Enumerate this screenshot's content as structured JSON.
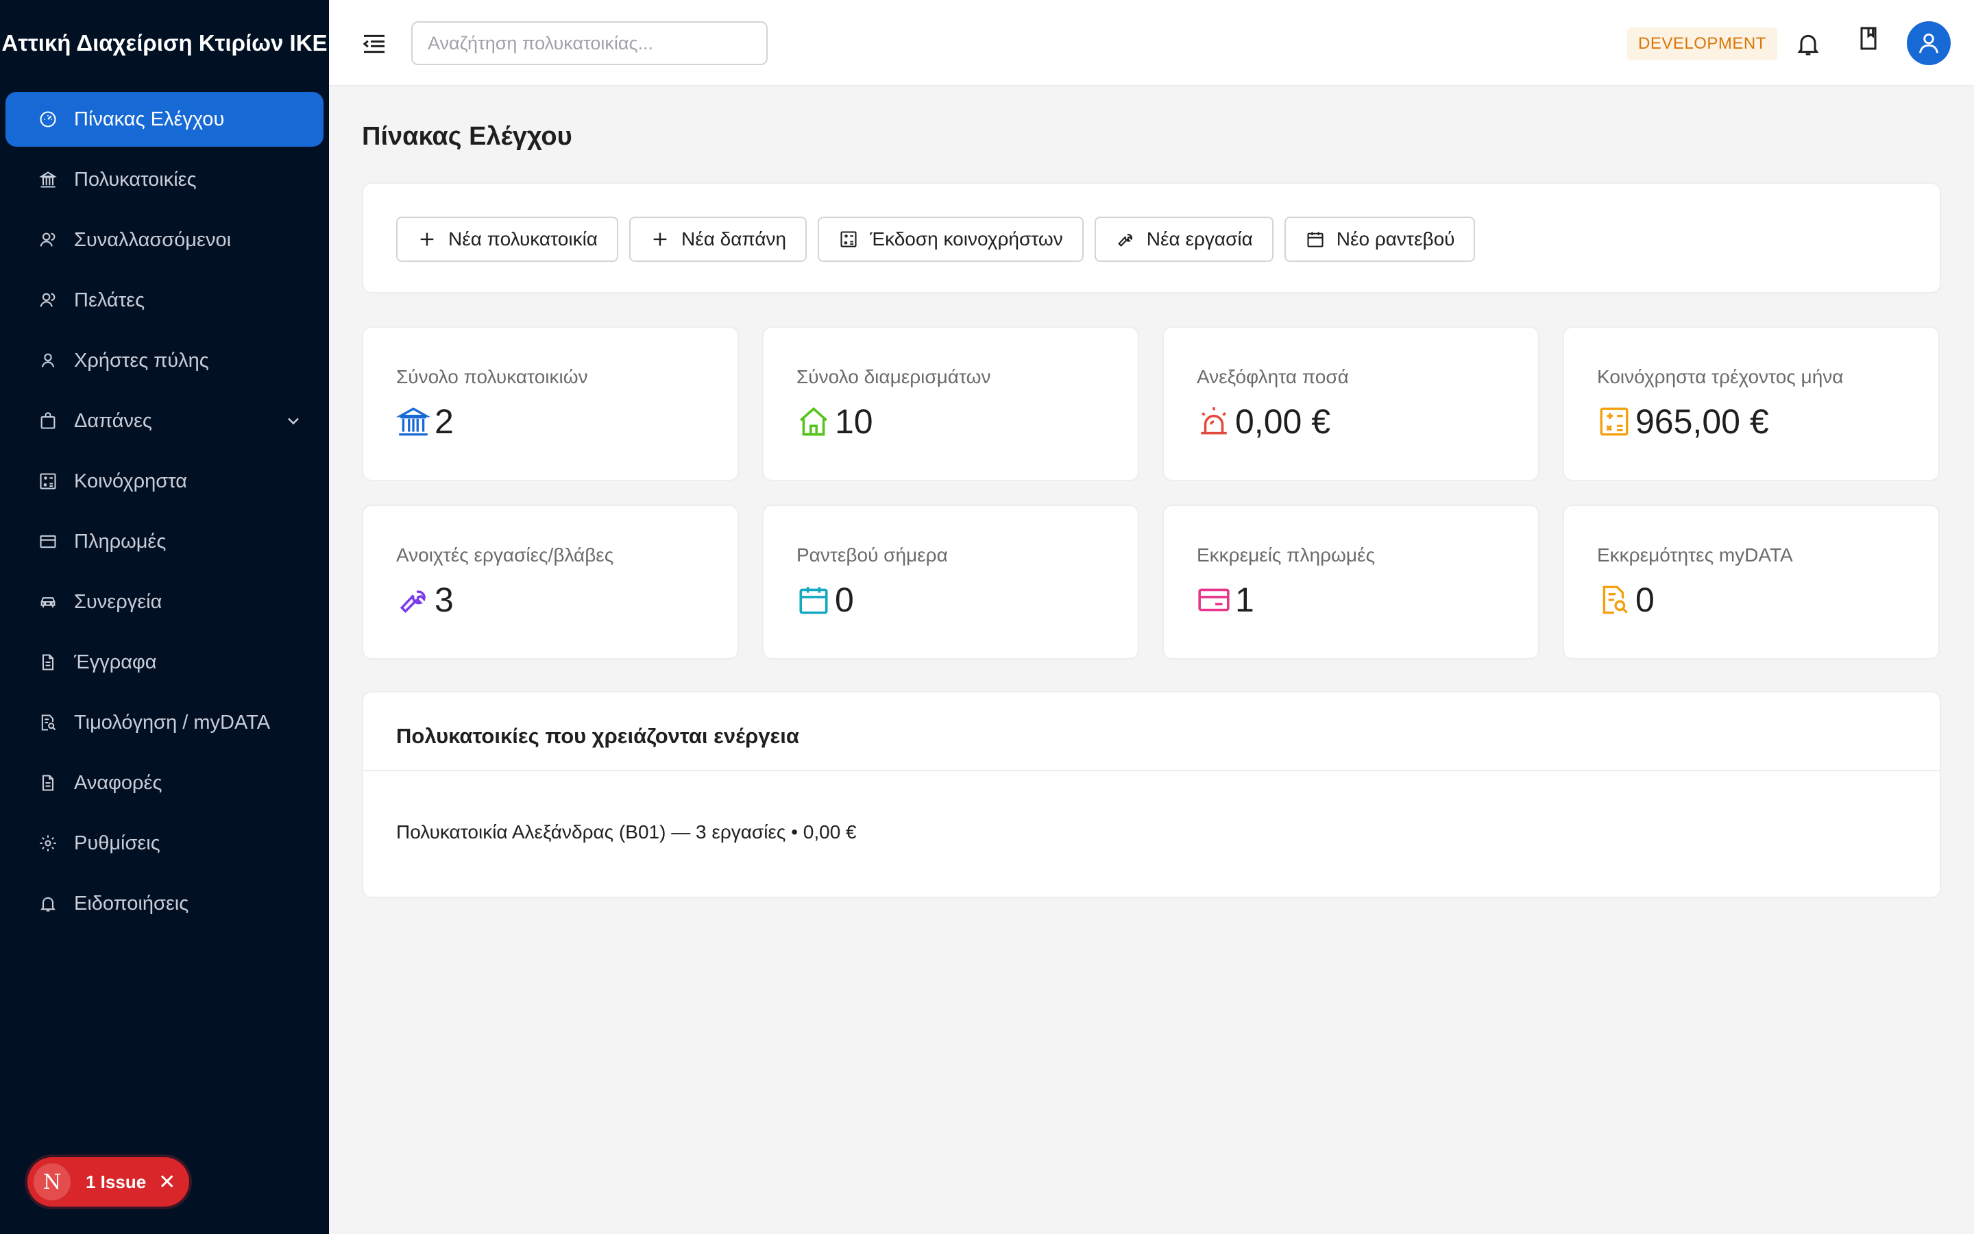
{
  "app": {
    "brand": "Αττική Διαχείριση Κτιρίων ΙΚΕ"
  },
  "sidebar": {
    "items": [
      {
        "label": "Πίνακας Ελέγχου",
        "icon": "dashboard-icon",
        "active": true
      },
      {
        "label": "Πολυκατοικίες",
        "icon": "building-icon"
      },
      {
        "label": "Συναλλασσόμενοι",
        "icon": "users-icon"
      },
      {
        "label": "Πελάτες",
        "icon": "users-icon"
      },
      {
        "label": "Χρήστες πύλης",
        "icon": "user-icon"
      },
      {
        "label": "Δαπάνες",
        "icon": "shopping-bag-icon",
        "expandable": true
      },
      {
        "label": "Κοινόχρηστα",
        "icon": "calculator-icon"
      },
      {
        "label": "Πληρωμές",
        "icon": "credit-card-icon"
      },
      {
        "label": "Συνεργεία",
        "icon": "car-icon"
      },
      {
        "label": "Έγγραφα",
        "icon": "document-icon"
      },
      {
        "label": "Τιμολόγηση / myDATA",
        "icon": "file-search-icon"
      },
      {
        "label": "Αναφορές",
        "icon": "report-icon"
      },
      {
        "label": "Ρυθμίσεις",
        "icon": "gear-icon"
      },
      {
        "label": "Ειδοποιήσεις",
        "icon": "bell-icon"
      }
    ]
  },
  "issues": {
    "badge": "N",
    "label": "1 Issue"
  },
  "header": {
    "search_placeholder": "Αναζήτηση πολυκατοικίας...",
    "env_badge": "DEVELOPMENT"
  },
  "page": {
    "title": "Πίνακας Ελέγχου"
  },
  "quick_actions": [
    {
      "label": "Νέα πολυκατοικία",
      "icon": "plus-icon"
    },
    {
      "label": "Νέα δαπάνη",
      "icon": "plus-icon"
    },
    {
      "label": "Έκδοση κοινοχρήστων",
      "icon": "calculator-icon"
    },
    {
      "label": "Νέα εργασία",
      "icon": "wrench-icon"
    },
    {
      "label": "Νέο ραντεβού",
      "icon": "calendar-icon"
    }
  ],
  "stats": [
    {
      "label": "Σύνολο πολυκατοικιών",
      "value": "2",
      "icon": "bank-icon",
      "color": "#1769d6"
    },
    {
      "label": "Σύνολο διαμερισμάτων",
      "value": "10",
      "icon": "home-icon",
      "color": "#52c41a"
    },
    {
      "label": "Ανεξόφλητα ποσά",
      "value": "0,00 €",
      "icon": "alarm-icon",
      "color": "#e14b3b"
    },
    {
      "label": "Κοινόχρηστα τρέχοντος μήνα",
      "value": "965,00 €",
      "icon": "calculator-icon",
      "color": "#f59f0b"
    },
    {
      "label": "Ανοιχτές εργασίες/βλάβες",
      "value": "3",
      "icon": "wrench-icon",
      "color": "#7c3aed"
    },
    {
      "label": "Ραντεβού σήμερα",
      "value": "0",
      "icon": "calendar-icon",
      "color": "#13a8c2"
    },
    {
      "label": "Εκκρεμείς πληρωμές",
      "value": "1",
      "icon": "credit-card-icon",
      "color": "#e6348a"
    },
    {
      "label": "Εκκρεμότητες myDATA",
      "value": "0",
      "icon": "file-search-icon",
      "color": "#f59f0b"
    }
  ],
  "needs_action": {
    "title": "Πολυκατοικίες που χρειάζονται ενέργεια",
    "items": [
      "Πολυκατοικία Αλεξάνδρας (B01) — 3 εργασίες • 0,00 €"
    ]
  }
}
